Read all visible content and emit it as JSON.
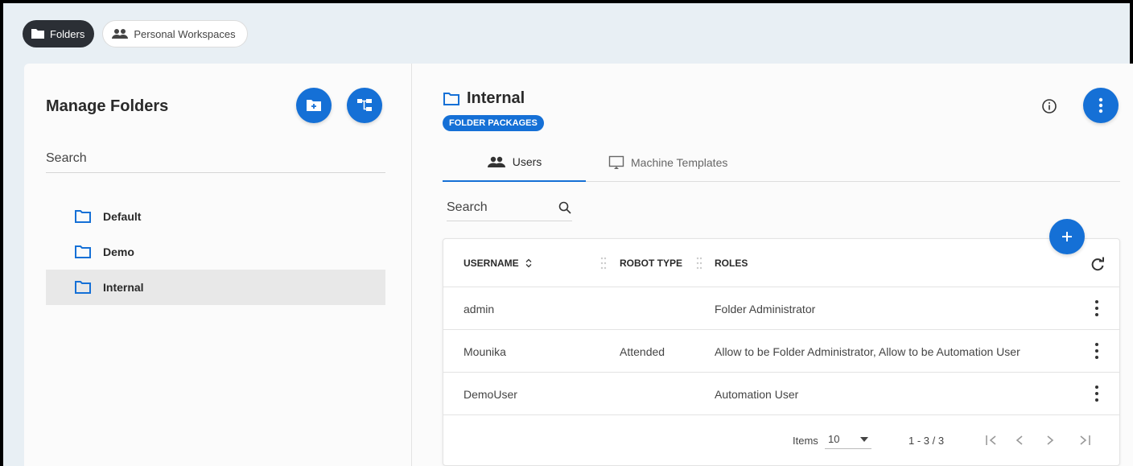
{
  "top_tabs": [
    {
      "label": "Folders",
      "icon": "folder-icon",
      "active": true
    },
    {
      "label": "Personal Workspaces",
      "icon": "people-icon",
      "active": false
    }
  ],
  "left_panel": {
    "title": "Manage Folders",
    "search_placeholder": "Search",
    "folders": [
      {
        "label": "Default",
        "selected": false
      },
      {
        "label": "Demo",
        "selected": false
      },
      {
        "label": "Internal",
        "selected": true
      }
    ]
  },
  "right_panel": {
    "title": "Internal",
    "badge": "FOLDER PACKAGES",
    "tabs": [
      {
        "label": "Users",
        "icon": "people-icon",
        "active": true
      },
      {
        "label": "Machine Templates",
        "icon": "monitor-icon",
        "active": false
      }
    ],
    "search_placeholder": "Search",
    "table": {
      "columns": [
        "USERNAME",
        "ROBOT TYPE",
        "ROLES"
      ],
      "rows": [
        {
          "username": "admin",
          "robot_type": "",
          "roles": "Folder Administrator"
        },
        {
          "username": "Mounika",
          "robot_type": "Attended",
          "roles": "Allow to be Folder Administrator, Allow to be Automation User"
        },
        {
          "username": "DemoUser",
          "robot_type": "",
          "roles": "Automation User"
        }
      ]
    },
    "pagination": {
      "items_label": "Items",
      "page_size": "10",
      "range": "1 - 3 / 3"
    }
  },
  "colors": {
    "accent": "#1570d6",
    "dark_chip": "#2b2f35",
    "page_bg": "#e8eff4"
  }
}
